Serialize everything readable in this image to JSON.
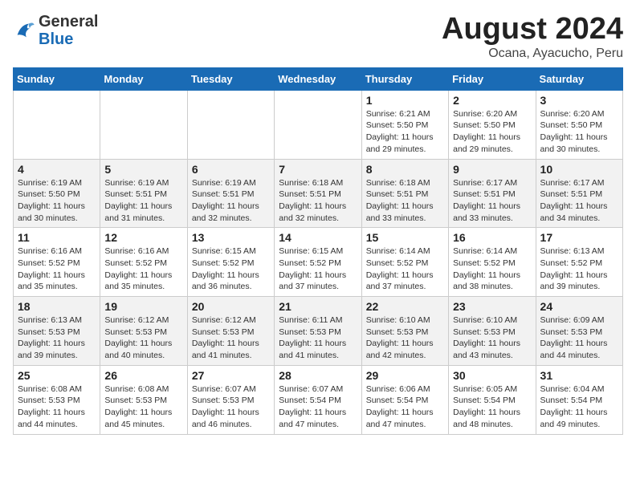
{
  "header": {
    "logo_general": "General",
    "logo_blue": "Blue",
    "title": "August 2024",
    "location": "Ocana, Ayacucho, Peru"
  },
  "weekdays": [
    "Sunday",
    "Monday",
    "Tuesday",
    "Wednesday",
    "Thursday",
    "Friday",
    "Saturday"
  ],
  "weeks": [
    [
      {
        "day": "",
        "sunrise": "",
        "sunset": "",
        "daylight": ""
      },
      {
        "day": "",
        "sunrise": "",
        "sunset": "",
        "daylight": ""
      },
      {
        "day": "",
        "sunrise": "",
        "sunset": "",
        "daylight": ""
      },
      {
        "day": "",
        "sunrise": "",
        "sunset": "",
        "daylight": ""
      },
      {
        "day": "1",
        "sunrise": "Sunrise: 6:21 AM",
        "sunset": "Sunset: 5:50 PM",
        "daylight": "Daylight: 11 hours and 29 minutes."
      },
      {
        "day": "2",
        "sunrise": "Sunrise: 6:20 AM",
        "sunset": "Sunset: 5:50 PM",
        "daylight": "Daylight: 11 hours and 29 minutes."
      },
      {
        "day": "3",
        "sunrise": "Sunrise: 6:20 AM",
        "sunset": "Sunset: 5:50 PM",
        "daylight": "Daylight: 11 hours and 30 minutes."
      }
    ],
    [
      {
        "day": "4",
        "sunrise": "Sunrise: 6:19 AM",
        "sunset": "Sunset: 5:50 PM",
        "daylight": "Daylight: 11 hours and 30 minutes."
      },
      {
        "day": "5",
        "sunrise": "Sunrise: 6:19 AM",
        "sunset": "Sunset: 5:51 PM",
        "daylight": "Daylight: 11 hours and 31 minutes."
      },
      {
        "day": "6",
        "sunrise": "Sunrise: 6:19 AM",
        "sunset": "Sunset: 5:51 PM",
        "daylight": "Daylight: 11 hours and 32 minutes."
      },
      {
        "day": "7",
        "sunrise": "Sunrise: 6:18 AM",
        "sunset": "Sunset: 5:51 PM",
        "daylight": "Daylight: 11 hours and 32 minutes."
      },
      {
        "day": "8",
        "sunrise": "Sunrise: 6:18 AM",
        "sunset": "Sunset: 5:51 PM",
        "daylight": "Daylight: 11 hours and 33 minutes."
      },
      {
        "day": "9",
        "sunrise": "Sunrise: 6:17 AM",
        "sunset": "Sunset: 5:51 PM",
        "daylight": "Daylight: 11 hours and 33 minutes."
      },
      {
        "day": "10",
        "sunrise": "Sunrise: 6:17 AM",
        "sunset": "Sunset: 5:51 PM",
        "daylight": "Daylight: 11 hours and 34 minutes."
      }
    ],
    [
      {
        "day": "11",
        "sunrise": "Sunrise: 6:16 AM",
        "sunset": "Sunset: 5:52 PM",
        "daylight": "Daylight: 11 hours and 35 minutes."
      },
      {
        "day": "12",
        "sunrise": "Sunrise: 6:16 AM",
        "sunset": "Sunset: 5:52 PM",
        "daylight": "Daylight: 11 hours and 35 minutes."
      },
      {
        "day": "13",
        "sunrise": "Sunrise: 6:15 AM",
        "sunset": "Sunset: 5:52 PM",
        "daylight": "Daylight: 11 hours and 36 minutes."
      },
      {
        "day": "14",
        "sunrise": "Sunrise: 6:15 AM",
        "sunset": "Sunset: 5:52 PM",
        "daylight": "Daylight: 11 hours and 37 minutes."
      },
      {
        "day": "15",
        "sunrise": "Sunrise: 6:14 AM",
        "sunset": "Sunset: 5:52 PM",
        "daylight": "Daylight: 11 hours and 37 minutes."
      },
      {
        "day": "16",
        "sunrise": "Sunrise: 6:14 AM",
        "sunset": "Sunset: 5:52 PM",
        "daylight": "Daylight: 11 hours and 38 minutes."
      },
      {
        "day": "17",
        "sunrise": "Sunrise: 6:13 AM",
        "sunset": "Sunset: 5:52 PM",
        "daylight": "Daylight: 11 hours and 39 minutes."
      }
    ],
    [
      {
        "day": "18",
        "sunrise": "Sunrise: 6:13 AM",
        "sunset": "Sunset: 5:53 PM",
        "daylight": "Daylight: 11 hours and 39 minutes."
      },
      {
        "day": "19",
        "sunrise": "Sunrise: 6:12 AM",
        "sunset": "Sunset: 5:53 PM",
        "daylight": "Daylight: 11 hours and 40 minutes."
      },
      {
        "day": "20",
        "sunrise": "Sunrise: 6:12 AM",
        "sunset": "Sunset: 5:53 PM",
        "daylight": "Daylight: 11 hours and 41 minutes."
      },
      {
        "day": "21",
        "sunrise": "Sunrise: 6:11 AM",
        "sunset": "Sunset: 5:53 PM",
        "daylight": "Daylight: 11 hours and 41 minutes."
      },
      {
        "day": "22",
        "sunrise": "Sunrise: 6:10 AM",
        "sunset": "Sunset: 5:53 PM",
        "daylight": "Daylight: 11 hours and 42 minutes."
      },
      {
        "day": "23",
        "sunrise": "Sunrise: 6:10 AM",
        "sunset": "Sunset: 5:53 PM",
        "daylight": "Daylight: 11 hours and 43 minutes."
      },
      {
        "day": "24",
        "sunrise": "Sunrise: 6:09 AM",
        "sunset": "Sunset: 5:53 PM",
        "daylight": "Daylight: 11 hours and 44 minutes."
      }
    ],
    [
      {
        "day": "25",
        "sunrise": "Sunrise: 6:08 AM",
        "sunset": "Sunset: 5:53 PM",
        "daylight": "Daylight: 11 hours and 44 minutes."
      },
      {
        "day": "26",
        "sunrise": "Sunrise: 6:08 AM",
        "sunset": "Sunset: 5:53 PM",
        "daylight": "Daylight: 11 hours and 45 minutes."
      },
      {
        "day": "27",
        "sunrise": "Sunrise: 6:07 AM",
        "sunset": "Sunset: 5:53 PM",
        "daylight": "Daylight: 11 hours and 46 minutes."
      },
      {
        "day": "28",
        "sunrise": "Sunrise: 6:07 AM",
        "sunset": "Sunset: 5:54 PM",
        "daylight": "Daylight: 11 hours and 47 minutes."
      },
      {
        "day": "29",
        "sunrise": "Sunrise: 6:06 AM",
        "sunset": "Sunset: 5:54 PM",
        "daylight": "Daylight: 11 hours and 47 minutes."
      },
      {
        "day": "30",
        "sunrise": "Sunrise: 6:05 AM",
        "sunset": "Sunset: 5:54 PM",
        "daylight": "Daylight: 11 hours and 48 minutes."
      },
      {
        "day": "31",
        "sunrise": "Sunrise: 6:04 AM",
        "sunset": "Sunset: 5:54 PM",
        "daylight": "Daylight: 11 hours and 49 minutes."
      }
    ]
  ]
}
